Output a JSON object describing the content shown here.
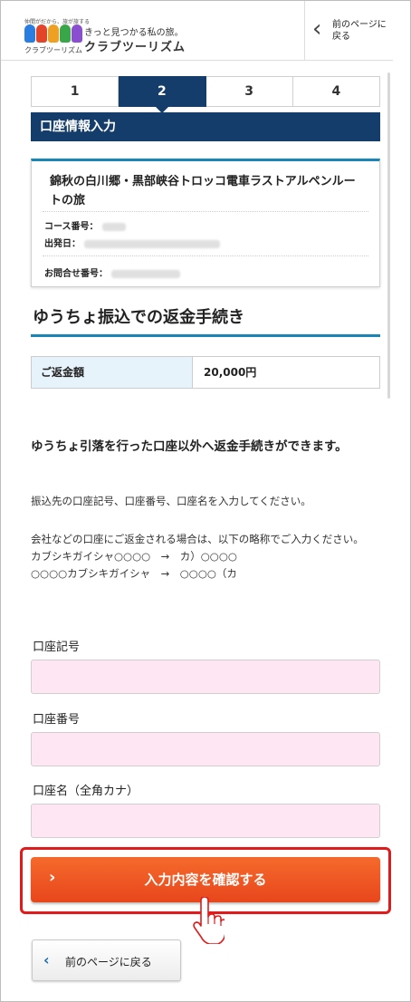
{
  "header": {
    "logo_tagline_small": "仲間がだから、旅が旅する",
    "logo_sub": "クラブツーリズム",
    "logo_tagline": "きっと見つかる私の旅。",
    "logo_name": "クラブツーリズム",
    "back_label": "前のページに戻る"
  },
  "steps": [
    "1",
    "2",
    "3",
    "4"
  ],
  "active_step": "2",
  "section_title": "口座情報入力",
  "tour": {
    "title": "錦秋の白川郷・黒部峡谷トロッコ電車ラストアルペンルートの旅",
    "course_label": "コース番号：",
    "departure_label": "出発日：",
    "inquiry_label": "お問合せ番号："
  },
  "heading": "ゆうちょ振込での返金手続き",
  "refund": {
    "label": "ご返金額",
    "value": "20,000円"
  },
  "lead": "ゆうちょ引落を行った口座以外へ返金手続きができます。",
  "instruction": "振込先の口座記号、口座番号、口座名を入力してください。",
  "note_lines": [
    "会社などの口座にご返金される場合は、以下の略称でご入力ください。",
    "カブシキガイシャ○○○○　→　カ）○○○○",
    "○○○○カブシキガイシャ　→　○○○○（カ"
  ],
  "fields": {
    "account_symbol_label": "口座記号",
    "account_number_label": "口座番号",
    "account_name_label": "口座名（全角カナ）"
  },
  "confirm_button": "入力内容を確認する",
  "back_button": "前のページに戻る",
  "colors": {
    "navy": "#143d6b",
    "accent_blue": "#1a86b8",
    "cta": "#ee5522",
    "input_bg": "#ffe6f2",
    "highlight": "#e21a1a"
  }
}
